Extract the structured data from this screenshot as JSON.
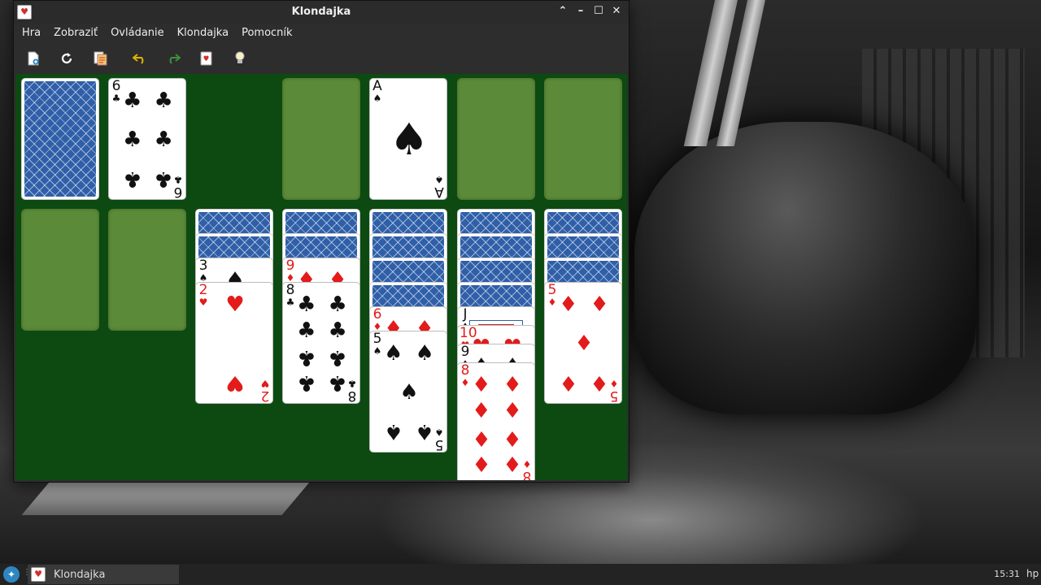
{
  "window": {
    "title": "Klondajka",
    "controls": [
      "chevron-up-icon",
      "minimize-icon",
      "maximize-icon",
      "close-icon"
    ]
  },
  "menu": [
    "Hra",
    "Zobraziť",
    "Ovládanie",
    "Klondajka",
    "Pomocník"
  ],
  "toolbar": [
    "new-game-icon",
    "restart-icon",
    "deal-cards-icon",
    "undo-icon",
    "redo-icon",
    "select-game-icon",
    "hint-icon"
  ],
  "colors": {
    "felt": "#0c4a12",
    "empty_slot": "#5b8a38",
    "card_back": "#2f5fa8",
    "red_suit": "#e31b1b",
    "black_suit": "#111111"
  },
  "game": {
    "stock": "face-down",
    "waste": {
      "rank": "6",
      "suit": "♣"
    },
    "foundations": [
      {
        "rank": "",
        "suit": ""
      },
      {
        "rank": "A",
        "suit": "♠"
      },
      {
        "rank": "",
        "suit": ""
      },
      {
        "rank": "",
        "suit": ""
      }
    ],
    "tableau": [
      {
        "hidden": 0,
        "visible": []
      },
      {
        "hidden": 0,
        "visible": []
      },
      {
        "hidden": 2,
        "visible": [
          {
            "rank": "3",
            "suit": "♠"
          },
          {
            "rank": "2",
            "suit": "♥"
          }
        ]
      },
      {
        "hidden": 2,
        "visible": [
          {
            "rank": "9",
            "suit": "♦"
          },
          {
            "rank": "8",
            "suit": "♣"
          }
        ]
      },
      {
        "hidden": 4,
        "visible": [
          {
            "rank": "6",
            "suit": "♦"
          },
          {
            "rank": "5",
            "suit": "♠"
          }
        ]
      },
      {
        "hidden": 4,
        "visible": [
          {
            "rank": "J",
            "suit": "♠"
          },
          {
            "rank": "10",
            "suit": "♥"
          },
          {
            "rank": "9",
            "suit": "♠"
          },
          {
            "rank": "8",
            "suit": "♦"
          }
        ]
      },
      {
        "hidden": 3,
        "visible": [
          {
            "rank": "5",
            "suit": "♦"
          }
        ]
      }
    ]
  },
  "taskbar": {
    "app_label": "Klondajka",
    "clock": "15:31",
    "user": "hp"
  }
}
